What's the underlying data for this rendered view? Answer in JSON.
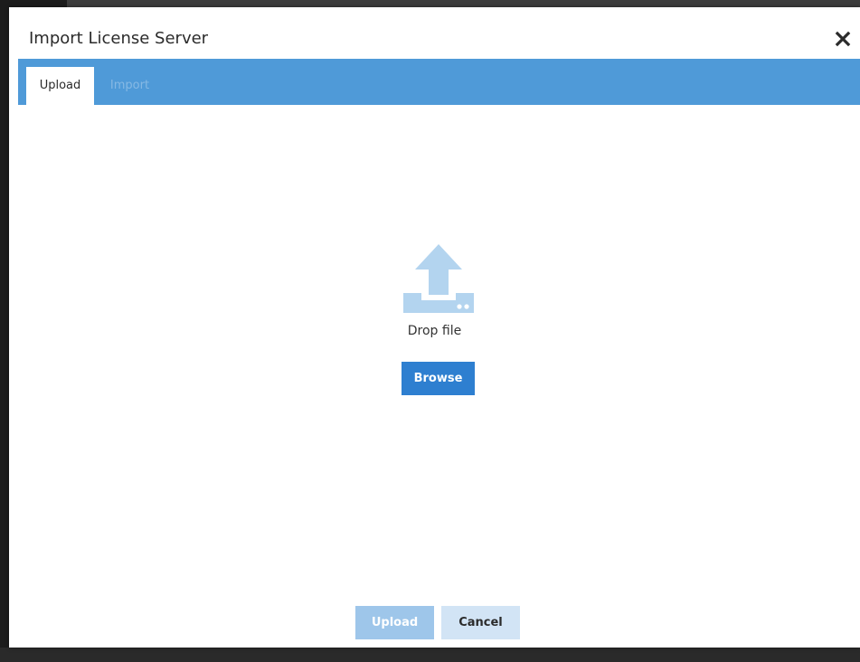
{
  "dialog": {
    "title": "Import License Server",
    "close_icon": "close-icon"
  },
  "tabs": [
    {
      "label": "Upload",
      "state": "active"
    },
    {
      "label": "Import",
      "state": "disabled"
    }
  ],
  "upload_area": {
    "icon": "upload-icon",
    "drop_text": "Drop file",
    "browse_label": "Browse"
  },
  "footer": {
    "upload_label": "Upload",
    "cancel_label": "Cancel"
  },
  "colors": {
    "tabbar": "#4f9ad8",
    "primary_button": "#2e7fd0",
    "disabled_button": "#9ec6ea",
    "secondary_button": "#d2e4f5",
    "icon": "#b3d4ef"
  }
}
